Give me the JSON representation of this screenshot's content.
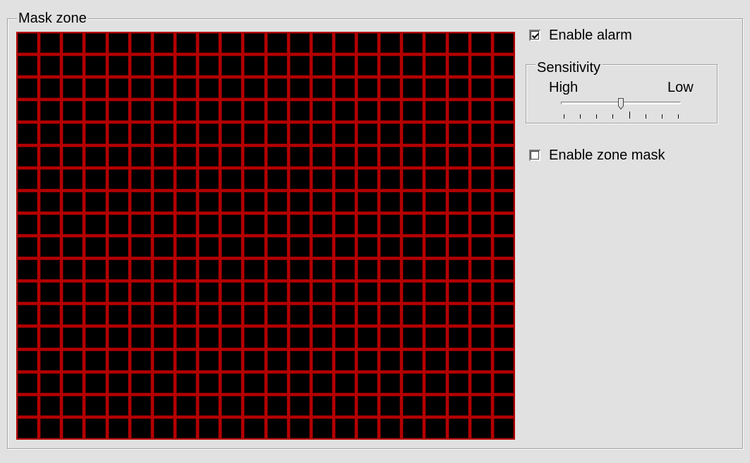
{
  "mask_zone": {
    "title": "Mask zone",
    "grid_columns": 22,
    "grid_rows": 18,
    "cell_border_color": "#b40000",
    "cell_fill_color": "#000000"
  },
  "alarm": {
    "label": "Enable alarm",
    "checked": true
  },
  "sensitivity": {
    "title": "Sensitivity",
    "high_label": "High",
    "low_label": "Low",
    "value_fraction": 0.5,
    "tick_count": 8
  },
  "zone_mask": {
    "label": "Enable zone mask",
    "checked": false
  }
}
